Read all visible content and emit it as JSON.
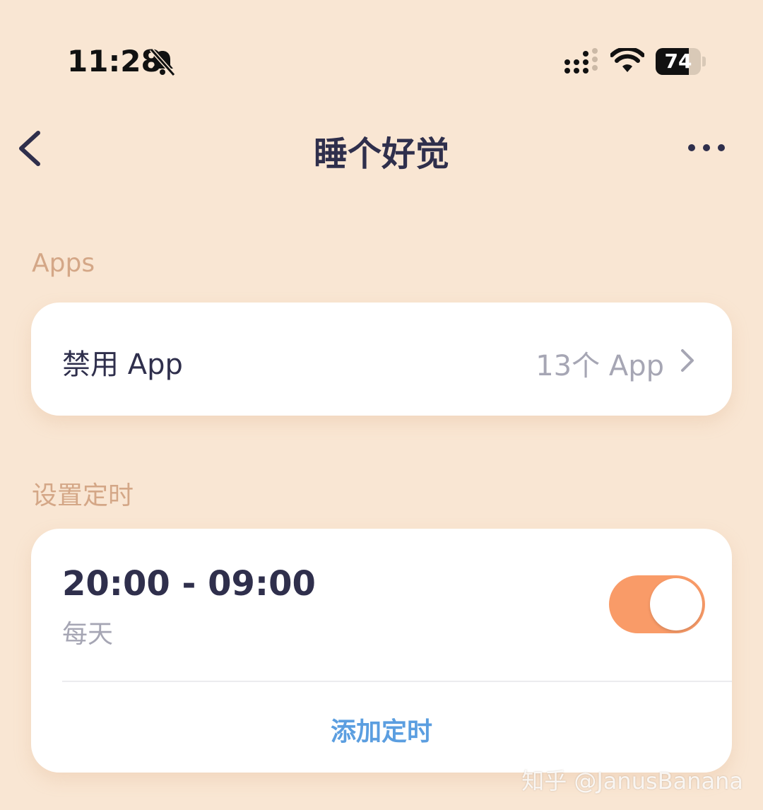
{
  "status_bar": {
    "time": "11:28",
    "battery_level": "74",
    "battery_fraction": 0.74,
    "icons": [
      "bell-slash-icon",
      "signal-icon",
      "wifi-icon",
      "battery-icon"
    ]
  },
  "nav": {
    "title": "睡个好觉",
    "back_icon": "chevron-left-icon",
    "more_icon": "more-dots-icon"
  },
  "apps_section": {
    "heading": "Apps",
    "row_label": "禁用 App",
    "row_value": "13个 App",
    "row_icon": "chevron-right-icon"
  },
  "schedule_section": {
    "heading": "设置定时",
    "schedule": {
      "time_range": "20:00 - 09:00",
      "repeat": "每天",
      "enabled": true
    },
    "add_label": "添加定时"
  },
  "watermark": "知乎 @JanusBanana",
  "colors": {
    "background": "#f9e6d3",
    "accent_toggle": "#f99b68",
    "link": "#5b9ee0",
    "section_heading": "#d4a787",
    "primary_text": "#2f2f4c",
    "secondary_text": "#a6a6b4"
  }
}
